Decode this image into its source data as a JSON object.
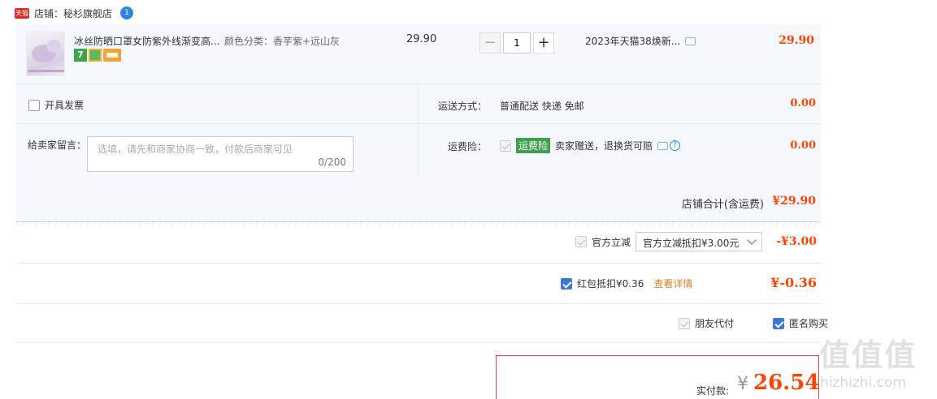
{
  "store": {
    "tmall_badge": "天猫",
    "label": "店铺：秘杉旗舰店",
    "chat_count": "1"
  },
  "product": {
    "title": "冰丝防晒口罩女防紫外线渐变高...",
    "sku": "颜色分类：香芋紫+远山灰",
    "badge_seven": "7",
    "unit_price": "29.90",
    "quantity": "1",
    "qty_minus": "−",
    "qty_plus": "+",
    "promotion": "2023年天猫38焕新...",
    "total": "29.90"
  },
  "options": {
    "invoice_label": "开具发票",
    "message_label": "给卖家留言：",
    "message_placeholder": "选填，请先和商家协商一致，付款后商家可见",
    "message_count": "0/200",
    "shipping_label": "运送方式：",
    "shipping_value": "普通配送 快递 免邮",
    "shipping_price": "0.00",
    "insurance_label": "运费险：",
    "insurance_badge": "运费险",
    "insurance_text": "卖家赠送，退换货可赔",
    "insurance_price": "0.00"
  },
  "store_total": {
    "label": "店铺合计(含运费)",
    "value": "¥29.90"
  },
  "discounts": {
    "official_label": "官方立减",
    "official_select": "官方立减抵扣¥3.00元",
    "official_amount": "-¥3.00",
    "redpack_label": "红包抵扣¥0.36",
    "redpack_link": "查看详情",
    "redpack_amount": "¥-0.36",
    "friend_pay": "朋友代付",
    "anonymous": "匿名购买"
  },
  "payment": {
    "label": "实付款:",
    "currency": "¥",
    "value": "26.54"
  },
  "watermark": {
    "chars": "值值值",
    "url": "zhizhizhi.com"
  },
  "colors": {
    "price_red": "#ff4400",
    "accent_blue": "#3a78d8",
    "panel_bg": "#f5f8fd",
    "insurance_green": "#3da24b"
  }
}
